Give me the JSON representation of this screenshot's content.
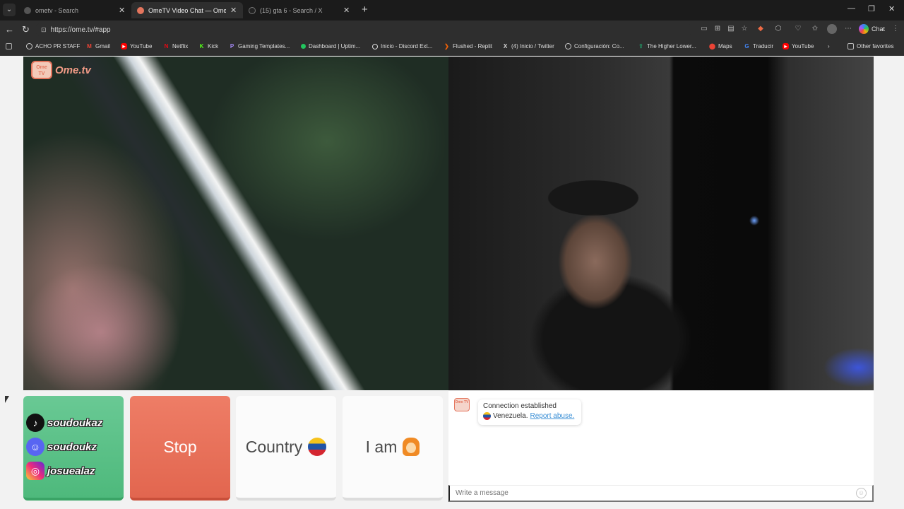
{
  "browser": {
    "tabs": [
      {
        "title": "ometv - Search",
        "active": false,
        "favicon_color": "#555555"
      },
      {
        "title": "OmeTV Video Chat — Omegle",
        "active": true,
        "favicon_color": "#e4755d"
      },
      {
        "title": "(15) gta 6 - Search / X",
        "active": false,
        "favicon_color": "#222222"
      }
    ],
    "url": "https://ome.tv/#app",
    "chat_button": "Chat",
    "other_favorites": "Other favorites",
    "bookmarks": [
      {
        "label": "ACHO PR STAFF",
        "icon": "globe-icon",
        "color": "#666666"
      },
      {
        "label": "Gmail",
        "icon": "gmail-icon",
        "color": "#ea4335"
      },
      {
        "label": "YouTube",
        "icon": "youtube-icon",
        "color": "#ff0000"
      },
      {
        "label": "Netflix",
        "icon": "netflix-icon",
        "color": "#e50914"
      },
      {
        "label": "Kick",
        "icon": "kick-icon",
        "color": "#53fc18"
      },
      {
        "label": "Gaming Templates...",
        "icon": "patreon-icon",
        "color": "#6d28d9"
      },
      {
        "label": "Dashboard | Uptim...",
        "icon": "uptime-icon",
        "color": "#22c55e"
      },
      {
        "label": "Inicio - Discord Ext...",
        "icon": "discord-icon",
        "color": "#dddddd"
      },
      {
        "label": "Flushed - Replit",
        "icon": "replit-icon",
        "color": "#f26207"
      },
      {
        "label": "(4) Inicio / Twitter",
        "icon": "x-icon",
        "color": "#111111"
      },
      {
        "label": "Configuración: Co...",
        "icon": "globe-icon",
        "color": "#666666"
      },
      {
        "label": "The Higher Lower...",
        "icon": "arrow-icon",
        "color": "#22a06b"
      },
      {
        "label": "Maps",
        "icon": "maps-icon",
        "color": "#ea4335"
      },
      {
        "label": "Traducir",
        "icon": "translate-icon",
        "color": "#4285f4"
      },
      {
        "label": "YouTube",
        "icon": "youtube-icon",
        "color": "#ff0000"
      }
    ]
  },
  "app": {
    "logo_text": "Ome.tv",
    "logo_badge": "Ome TV",
    "social": [
      {
        "handle": "soudoukaz",
        "icon": "tiktok-icon",
        "color": "#111111"
      },
      {
        "handle": "soudoukz",
        "icon": "discord-icon",
        "color": "#5865f2"
      },
      {
        "handle": "josuealaz",
        "icon": "instagram-icon",
        "color": "#d6249f"
      }
    ],
    "stop_label": "Stop",
    "country_label": "Country",
    "iam_label": "I am",
    "chat": {
      "status": "Connection established",
      "country": "Venezuela.",
      "report_link": "Report abuse.",
      "placeholder": "Write a message"
    }
  }
}
